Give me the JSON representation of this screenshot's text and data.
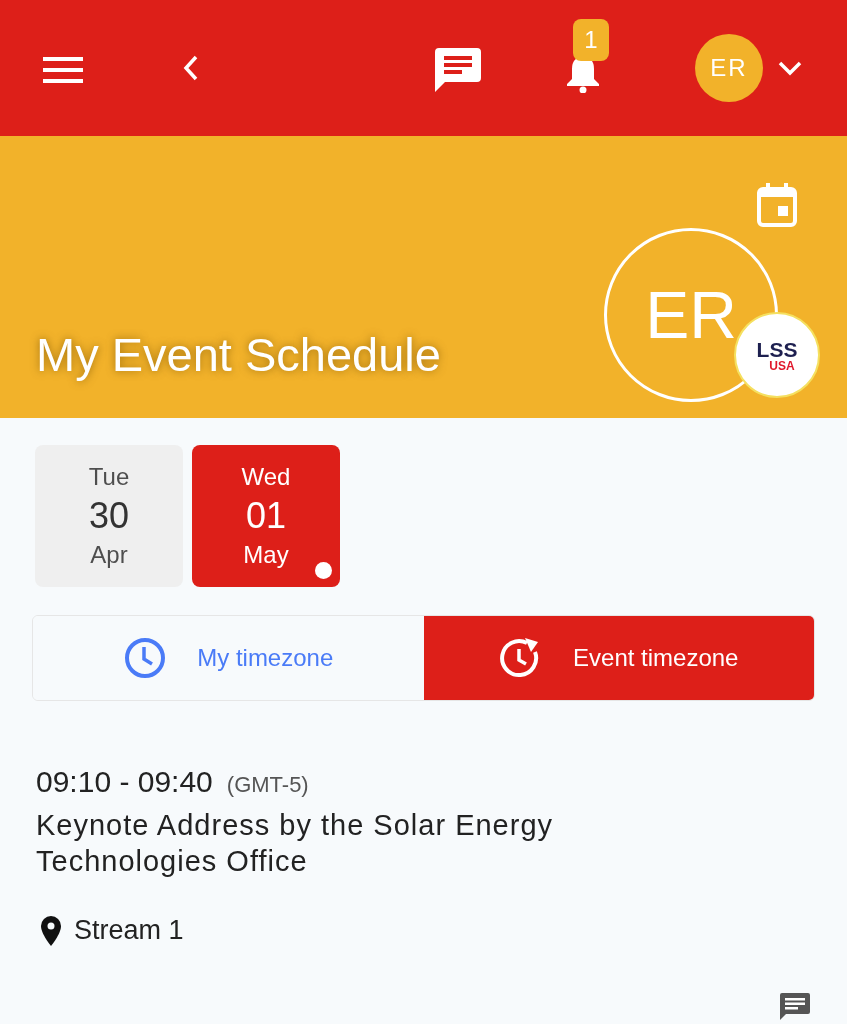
{
  "top_bar": {
    "notification_count": "1",
    "avatar_initials": "ER"
  },
  "header": {
    "title": "My Event Schedule",
    "avatar_initials": "ER",
    "badge_line_1": "LSS",
    "badge_line_2": "USA"
  },
  "days": [
    {
      "weekday": "Tue",
      "day": "30",
      "month": "Apr",
      "selected": false,
      "has_events": false
    },
    {
      "weekday": "Wed",
      "day": "01",
      "month": "May",
      "selected": true,
      "has_events": true
    }
  ],
  "timezone_tabs": [
    {
      "label": "My timezone",
      "kind": "clock",
      "selected": false
    },
    {
      "label": "Event timezone",
      "kind": "reset",
      "selected": true
    }
  ],
  "sessions": [
    {
      "time": "09:10 - 09:40",
      "timezone": "(GMT-5)",
      "title": "Keynote Address by the Solar Energy Technologies Office",
      "location": "Stream 1"
    }
  ]
}
